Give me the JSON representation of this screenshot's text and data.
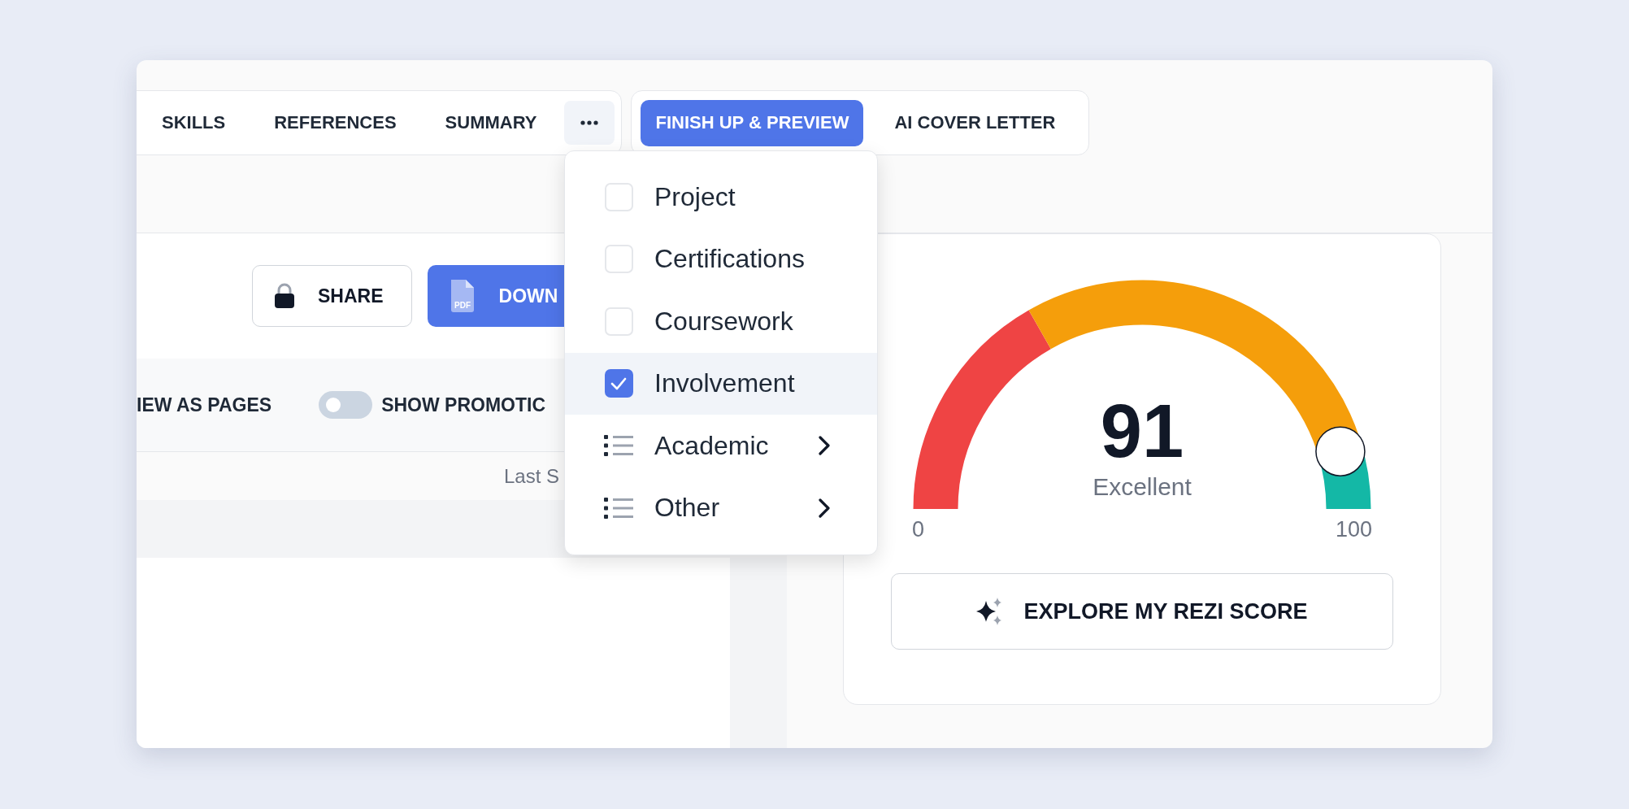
{
  "nav": {
    "section_tabs": [
      {
        "label": "SKILLS",
        "selected": false
      },
      {
        "label": "REFERENCES",
        "selected": false
      },
      {
        "label": "SUMMARY",
        "selected": false
      }
    ],
    "step_tabs": [
      {
        "label": "FINISH UP & PREVIEW",
        "selected": true
      },
      {
        "label": "AI COVER LETTER",
        "selected": false
      }
    ]
  },
  "actions": [
    {
      "kind": "share",
      "label": "SHARE"
    },
    {
      "kind": "download",
      "label": "DOWN",
      "icon_text": "PDF"
    }
  ],
  "view_bar": {
    "view_as_pages": "IEW AS PAGES",
    "promotions": {
      "label": "SHOW PROMOTIC",
      "on": false
    }
  },
  "last_saved": "Last S",
  "more_menu": [
    {
      "kind": "checkbox",
      "label": "Project",
      "checked": false,
      "highlighted": false
    },
    {
      "kind": "checkbox",
      "label": "Certifications",
      "checked": false,
      "highlighted": false
    },
    {
      "kind": "checkbox",
      "label": "Coursework",
      "checked": false,
      "highlighted": false
    },
    {
      "kind": "checkbox",
      "label": "Involvement",
      "checked": true,
      "highlighted": true
    },
    {
      "kind": "submenu",
      "label": "Academic",
      "highlighted": false
    },
    {
      "kind": "submenu",
      "label": "Other",
      "highlighted": false
    }
  ],
  "score": {
    "value": "91",
    "rating": "Excellent",
    "level": 0.91,
    "min_label": "0",
    "max_label": "100",
    "button": "EXPLORE MY REZI SCORE"
  }
}
